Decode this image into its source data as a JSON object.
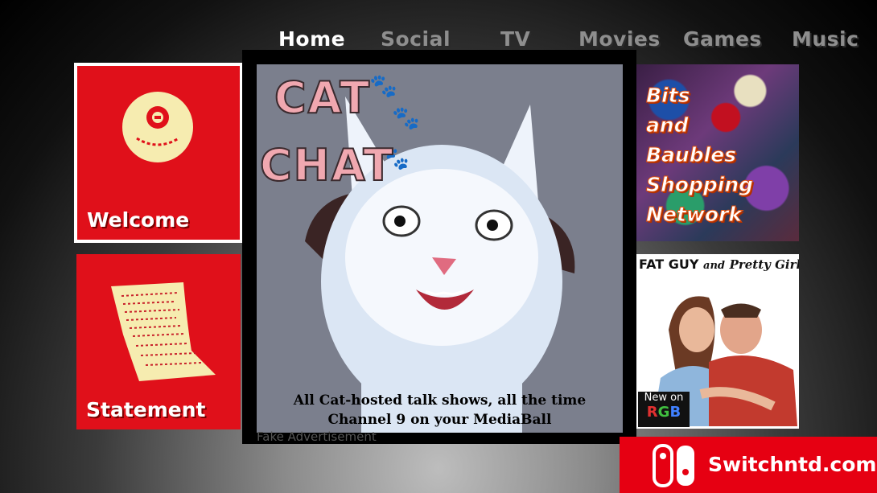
{
  "nav": {
    "items": [
      {
        "label": "Home",
        "active": true
      },
      {
        "label": "Social",
        "active": false
      },
      {
        "label": "TV",
        "active": false
      },
      {
        "label": "Movies",
        "active": false
      },
      {
        "label": "Games",
        "active": false
      },
      {
        "label": "Music",
        "active": false
      }
    ]
  },
  "tiles": {
    "welcome": {
      "label": "Welcome",
      "selected": true
    },
    "statement": {
      "label": "Statement"
    }
  },
  "featured": {
    "title_line1": "CAT",
    "title_line2": "CHAT",
    "caption_line1": "All Cat-hosted talk shows, all the time",
    "caption_line2": "Channel 9 on your MediaBall",
    "disclaimer": "Fake Advertisement"
  },
  "side_tiles": {
    "bits": {
      "lines": [
        "Bits",
        "and",
        "Baubles",
        "Shopping",
        "Network"
      ]
    },
    "fatguy": {
      "title_a": "FAT GUY",
      "title_b": "and",
      "title_c": "Pretty Girl",
      "badge_line1": "New on",
      "badge_line2": "RGB"
    }
  },
  "watermark": {
    "text": "Switchntd.com"
  },
  "colors": {
    "tile_red": "#e0101a",
    "nav_active": "#ffffff",
    "nav_inactive": "#8e8e8e",
    "watermark_red": "#e60012"
  }
}
